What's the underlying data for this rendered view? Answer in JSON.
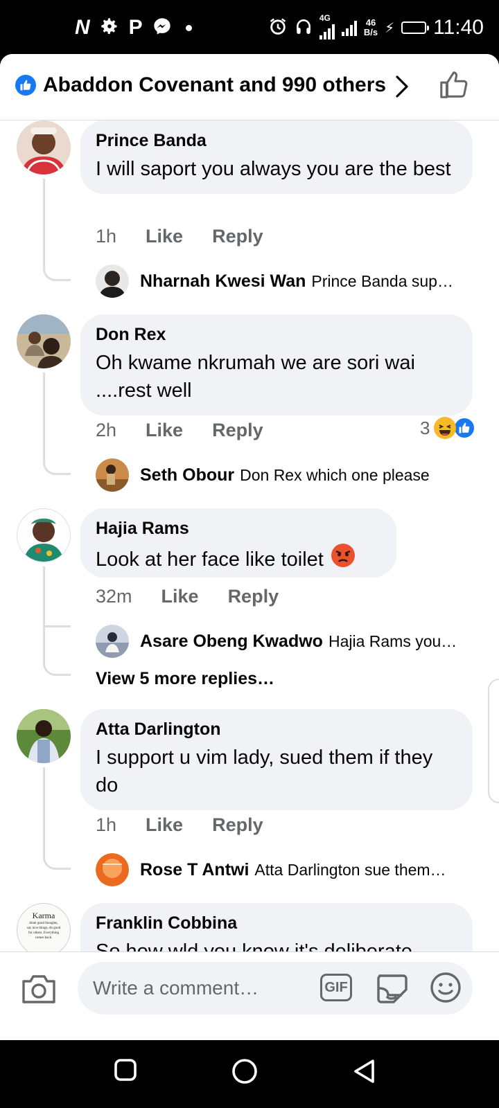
{
  "status_bar": {
    "time": "11:40",
    "left_icons": [
      "netflix-n",
      "gear",
      "p-app",
      "messenger"
    ],
    "network_type": "4G",
    "net_speed_value": "46",
    "net_speed_unit": "B/s"
  },
  "header": {
    "reactors_text": "Abaddon Covenant and 990 others"
  },
  "comments": [
    {
      "name": "Prince Banda",
      "text": "I will saport you always you are the best",
      "time": "1h",
      "like_label": "Like",
      "reply_label": "Reply",
      "reply": {
        "name": "Nharnah Kwesi Wan",
        "text": "Prince Banda sup…"
      }
    },
    {
      "name": "Don Rex",
      "text": "Oh kwame nkrumah we are sori wai ....rest well",
      "time": "2h",
      "like_label": "Like",
      "reply_label": "Reply",
      "reaction_count": "3",
      "reaction_icons": [
        "laugh",
        "like"
      ],
      "reply": {
        "name": "Seth Obour",
        "text": "Don Rex which one please"
      }
    },
    {
      "name": "Hajia Rams",
      "text": "Look at her face like toilet",
      "emoji": "angry-face",
      "time": "32m",
      "like_label": "Like",
      "reply_label": "Reply",
      "reply": {
        "name": "Asare Obeng Kwadwo",
        "text": "Hajia Rams you…"
      },
      "view_more": "View 5 more replies…"
    },
    {
      "name": "Atta Darlington",
      "text": "I support u vim lady, sued them if they do",
      "time": "1h",
      "like_label": "Like",
      "reply_label": "Reply",
      "reply": {
        "name": "Rose T Antwi",
        "text": "Atta Darlington sue them…"
      }
    },
    {
      "name": "Franklin Cobbina",
      "text": "So how wld you know it's deliberate",
      "avatar_lines": [
        "Karma",
        "think good thoughts,",
        "say nice things, do good",
        "for others. Everything",
        "comes back."
      ]
    }
  ],
  "composer": {
    "placeholder": "Write a comment…",
    "gif_label": "GIF"
  },
  "colors": {
    "facebook_blue": "#1877f2",
    "bubble_bg": "#f0f2f5",
    "secondary_text": "#65676b"
  }
}
